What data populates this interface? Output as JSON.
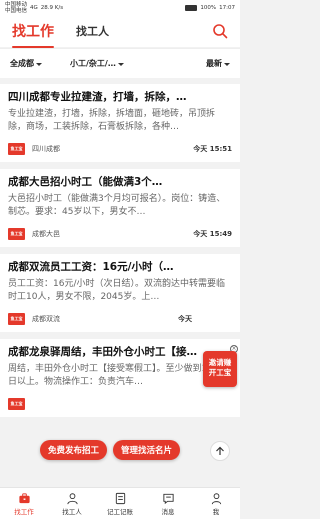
{
  "status": {
    "carrier1": "中国移动",
    "carrier2": "中国电信",
    "network": "4G",
    "speed": "28.9 K/s",
    "battery": "100%",
    "time": "17:07"
  },
  "header": {
    "active_tab": "找工作",
    "tab2": "找工人"
  },
  "filters": {
    "city": "全成都",
    "type": "小工/杂工/…",
    "sort": "最新"
  },
  "jobs": [
    {
      "title": "四川成都专业拉建渣，打墙，拆除，…",
      "desc": "专业拉建渣，打墙，拆除，拆墙面，砸地砖，吊顶拆除，商场，工装拆除，石膏板拆除，各种…",
      "logo": "鱼工宝",
      "company": "四川成都",
      "time": "今天 15:51"
    },
    {
      "title": "成都大邑招小时工（能做满3个…",
      "desc": "大邑招小时工（能做满3个月均可报名）。岗位：铸造、制芯。要求：45岁以下，男女不…",
      "logo": "鱼工宝",
      "company": "成都大邑",
      "time": "今天 15:49"
    },
    {
      "title": "成都双流员工工资：16元/小时（…",
      "desc": "员工工资：16元/小时（次日结）。双流韵达中转需要临时工10人，男女不限，2045岁。上…",
      "logo": "鱼工宝",
      "company": "成都双流",
      "time": "今天"
    },
    {
      "title": "成都龙泉驿周结，丰田外仓小时工【接…",
      "desc": "周结，丰田外仓小时工【接受寒假工】。至少做到1月26日以上。物流操作工：负责汽车…",
      "logo": "鱼工宝",
      "company": "",
      "time": ""
    }
  ],
  "float_ad": {
    "line1": "邀请赚",
    "line2": "开工宝"
  },
  "actions": {
    "post_job": "免费发布招工",
    "manage_card": "管理找活名片"
  },
  "tabbar": {
    "items": [
      "找工作",
      "找工人",
      "记工记账",
      "消息",
      "我"
    ]
  },
  "colors": {
    "accent": "#e4392b"
  }
}
